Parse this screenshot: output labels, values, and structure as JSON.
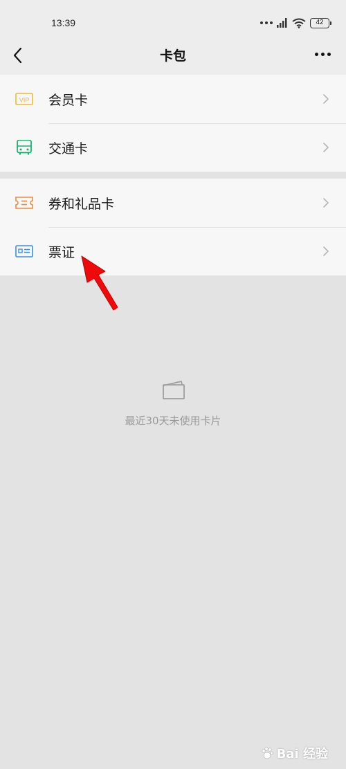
{
  "status_bar": {
    "time": "13:39",
    "battery": "42"
  },
  "nav": {
    "title": "卡包",
    "back_icon": "chevron-left-icon",
    "more_icon": "more-dots-icon"
  },
  "groups": [
    {
      "items": [
        {
          "label": "会员卡",
          "icon": "vip-card-icon",
          "color": "#f0b932"
        },
        {
          "label": "交通卡",
          "icon": "bus-icon",
          "color": "#17b26a"
        }
      ]
    },
    {
      "items": [
        {
          "label": "券和礼品卡",
          "icon": "ticket-icon",
          "color": "#ee8a3a"
        },
        {
          "label": "票证",
          "icon": "id-card-icon",
          "color": "#3b8fe0"
        }
      ]
    }
  ],
  "empty_state": {
    "icon": "empty-card-icon",
    "text": "最近30天未使用卡片"
  },
  "annotation": {
    "arrow_color": "#ee0a0a"
  },
  "watermark": {
    "text": "Bai 经验"
  }
}
